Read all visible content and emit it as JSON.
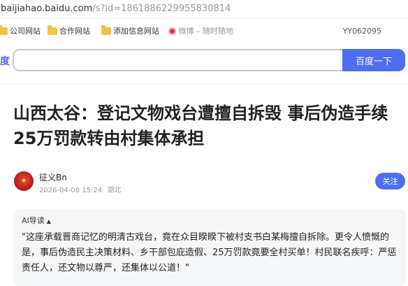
{
  "address_bar": {
    "host": "baijiahao.baidu.com",
    "path": "/s?id=1861886229955830814"
  },
  "bookmarks": {
    "items": [
      {
        "label": "公司网站",
        "icon": "folder-icon"
      },
      {
        "label": "合作网站",
        "icon": "folder-icon"
      },
      {
        "label": "添加信息网站",
        "icon": "folder-icon"
      },
      {
        "label": "微博 – 随时随地",
        "icon": "weibo-icon"
      }
    ],
    "right_label": "YY062095"
  },
  "search": {
    "accent": "度",
    "button_label": "百度一下",
    "value": "",
    "placeholder": ""
  },
  "article": {
    "title": "山西太谷：登记文物戏台遭擅自拆毁 事后伪造手续25万罚款转由村集体承担",
    "author": {
      "name": "征义Bn",
      "date": "2026-04-08 15:24",
      "location": "湖北"
    },
    "follow_label": "关注"
  },
  "ai_summary": {
    "header": "AI导读",
    "caret": "▲",
    "text": "\"这座承载晋商记忆的明清古戏台，竟在众目睽睽下被村支书白某梅擅自拆除。更令人愤慨的是，事后伪造民主决策材料、乡干部包庇造假、25万罚款竟要全村买单！村民联名疾呼：严惩责任人，还文物以尊严，还集体以公道！\""
  },
  "colors": {
    "accent": "#4e6ef2",
    "folder": "#f5c242",
    "weibo": "#e6162d",
    "title": "#222222",
    "meta": "#999999",
    "ai_background": "#f5f6f7"
  }
}
